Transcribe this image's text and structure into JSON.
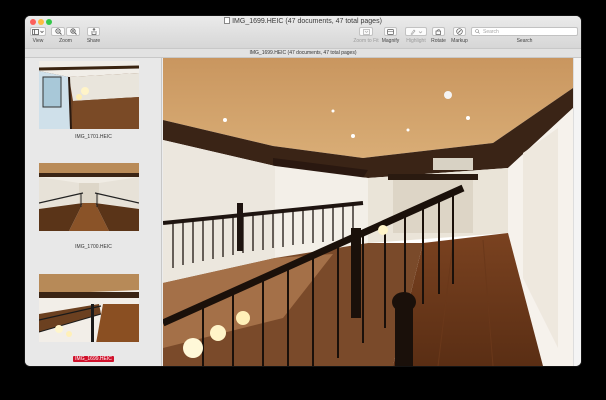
{
  "window": {
    "title": "IMG_1699.HEIC (47 documents, 47 total pages)",
    "subtitle": "IMG_1699.HEIC (47 documents, 47 total pages)"
  },
  "toolbar": {
    "view_label": "View",
    "zoom_label": "Zoom",
    "share_label": "Share",
    "zoom_to_fit_label": "Zoom to Fit",
    "magnify_label": "Magnify",
    "highlight_label": "Highlight",
    "rotate_label": "Rotate",
    "markup_label": "Markup",
    "search_label": "Search",
    "search_placeholder": "Search"
  },
  "sidebar": {
    "thumbnails": [
      {
        "label": "IMG_1701.HEIC",
        "selected": false
      },
      {
        "label": "IMG_1700.HEIC",
        "selected": false
      },
      {
        "label": "IMG_1699.HEIC",
        "selected": true
      }
    ]
  },
  "colors": {
    "selection": "#d0112b",
    "close": "#fc605c",
    "minimize": "#fdbc40",
    "maximize": "#34c84a"
  }
}
